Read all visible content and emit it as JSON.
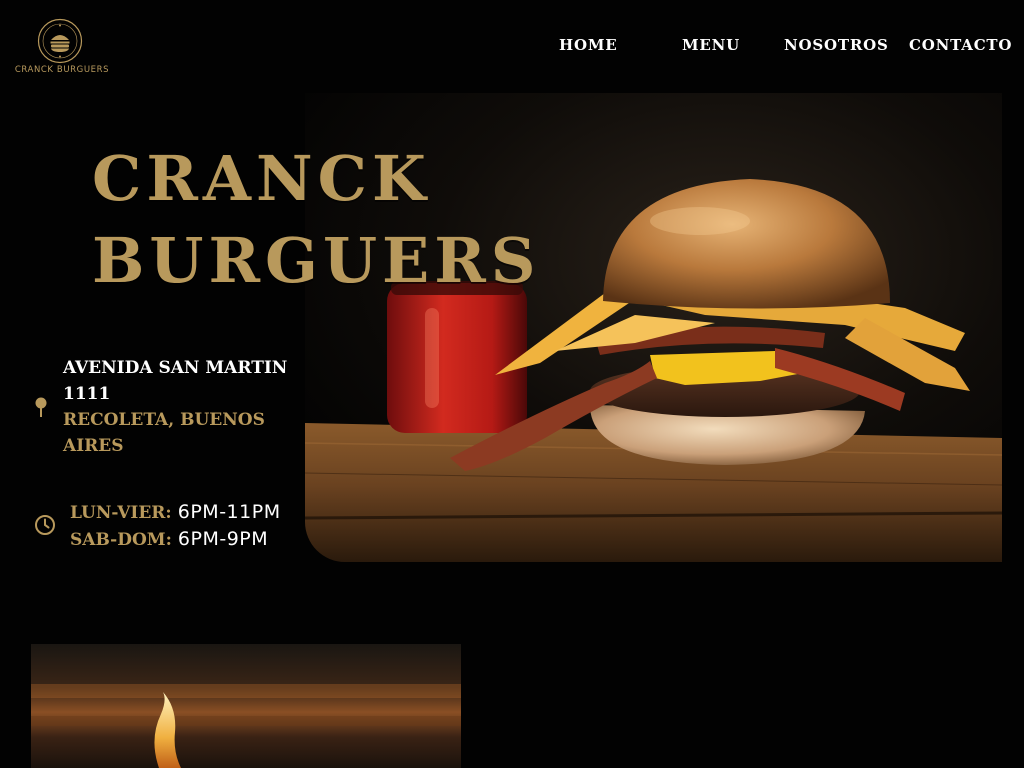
{
  "brand": {
    "name": "CRANCK BURGUERS",
    "icon": "burger-logo-icon"
  },
  "nav": {
    "items": [
      "HOME",
      "MENU",
      "NOSOTROS",
      "CONTACTO"
    ]
  },
  "hero": {
    "title_line1": "CRANCK",
    "title_line2": "BURGUERS",
    "image": "burger-photo"
  },
  "address": {
    "icon": "location-pin-icon",
    "street": "AVENIDA SAN MARTIN 1111",
    "city": "RECOLETA, BUENOS AIRES"
  },
  "hours": {
    "icon": "clock-icon",
    "weekday_label": "LUN-VIER:",
    "weekday_value": "6PM-11PM",
    "weekend_label": "SAB-DOM:",
    "weekend_value": "6PM-9PM"
  },
  "colors": {
    "background": "#020202",
    "accent_gold": "#b8995c",
    "text_white": "#ffffff"
  }
}
